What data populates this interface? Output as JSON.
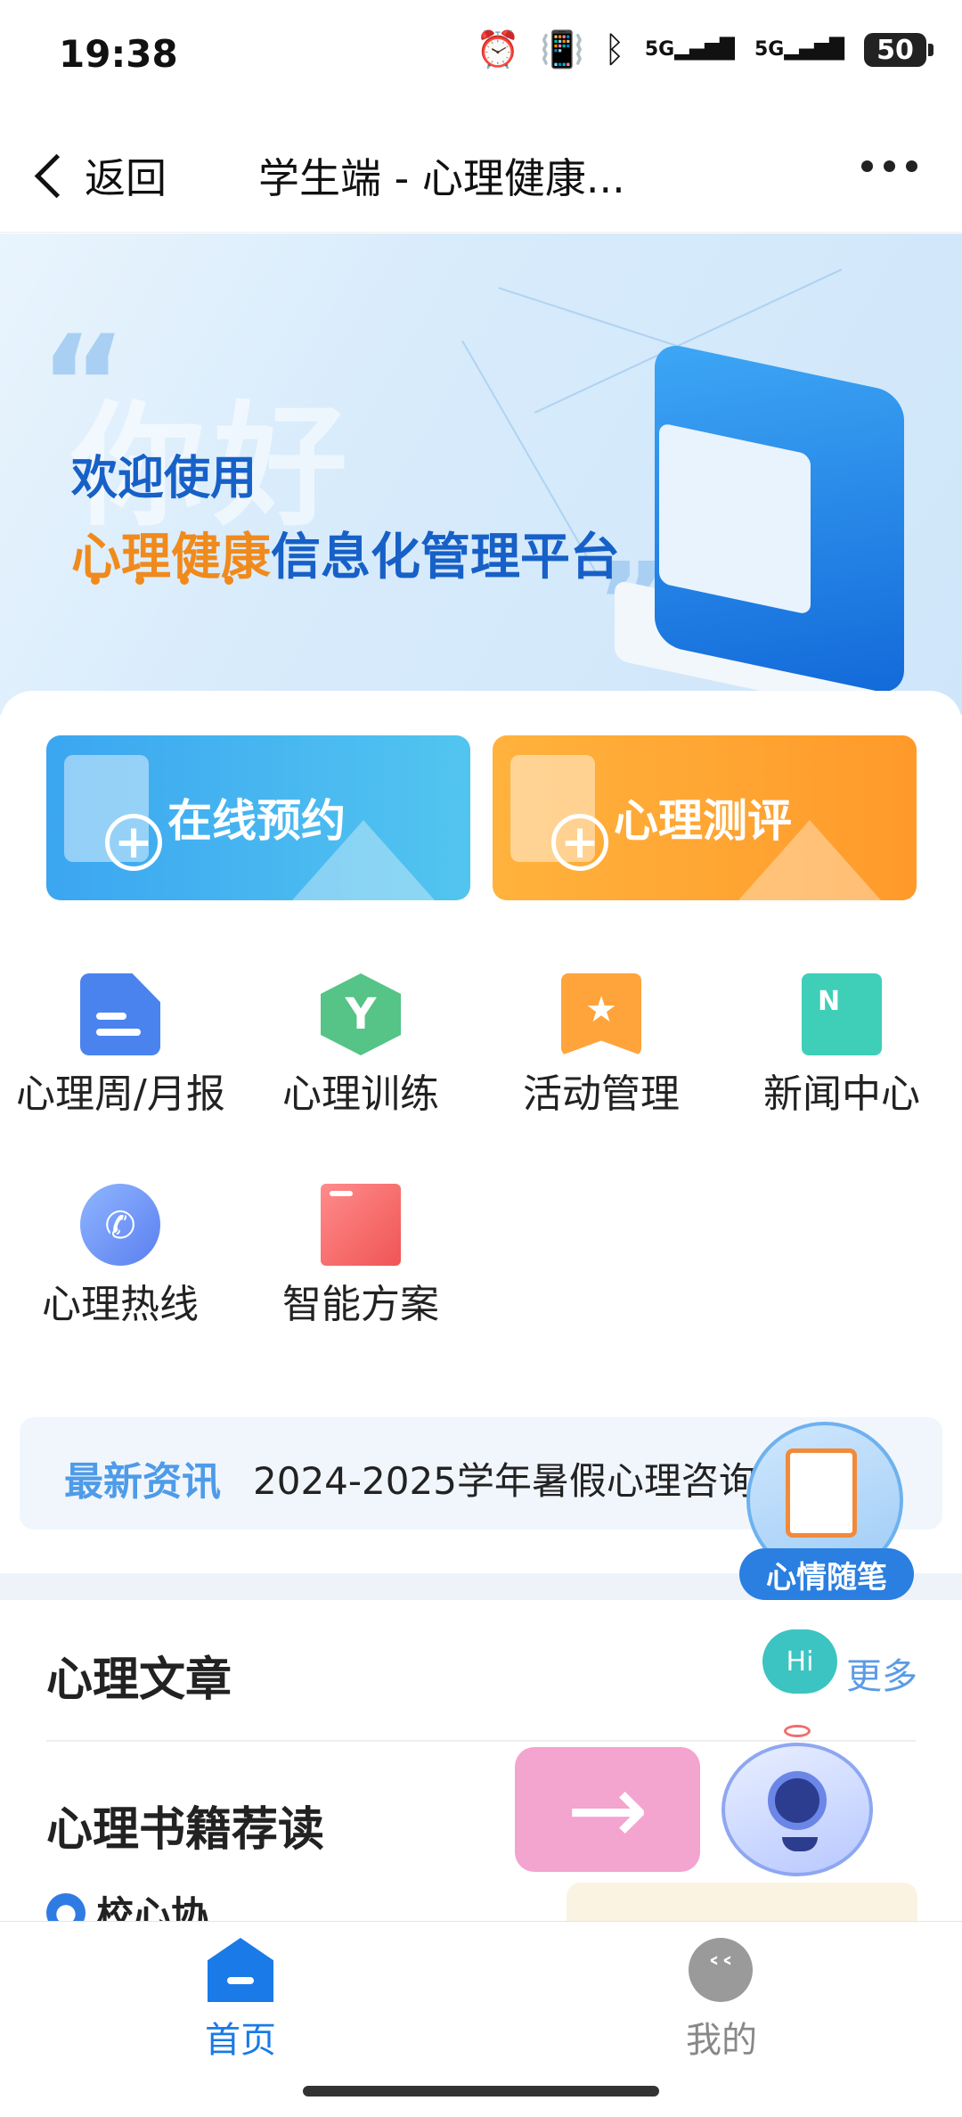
{
  "status_bar": {
    "time": "19:38",
    "icons": [
      "alarm-icon",
      "vibrate-icon",
      "bluetooth-icon",
      "signal-5g-icon",
      "signal-5g-icon"
    ],
    "signal_label_1": "5G",
    "signal_label_2": "5G",
    "battery": "50"
  },
  "title_bar": {
    "back_label": "返回",
    "title": "学生端 - 心理健康...",
    "more_icon": "more-dots-icon"
  },
  "banner": {
    "watermark": "你好",
    "line1": "欢迎使用",
    "line2_highlight": "心理健康",
    "line2_rest": "信息化管理平台"
  },
  "quick_actions": [
    {
      "label": "在线预约",
      "color": "#3ba6f1"
    },
    {
      "label": "心理测评",
      "color": "#ffa733"
    }
  ],
  "services": [
    {
      "label": "心理周/月报",
      "icon": "document-icon"
    },
    {
      "label": "心理训练",
      "icon": "training-hexagon-icon",
      "glyph": "Y"
    },
    {
      "label": "活动管理",
      "icon": "star-bookmark-icon",
      "glyph": "★"
    },
    {
      "label": "新闻中心",
      "icon": "news-book-icon",
      "glyph": "N"
    },
    {
      "label": "心理热线",
      "icon": "phone-icon",
      "glyph": "✆"
    },
    {
      "label": "智能方案",
      "icon": "folder-icon"
    }
  ],
  "news": {
    "tag": "最新资讯",
    "text": "2024-2025学年暑假心理咨询"
  },
  "floating": {
    "note_label": "心情随笔",
    "hi_label": "Hi",
    "arrow_glyph": "→"
  },
  "sections": {
    "articles_title": "心理文章",
    "more_label": "更多",
    "books_title": "心理书籍荐读",
    "author": "校心协"
  },
  "bottom_nav": {
    "home_label": "首页",
    "mine_label": "我的",
    "active": "首页",
    "accent": "#1a7ae8"
  }
}
